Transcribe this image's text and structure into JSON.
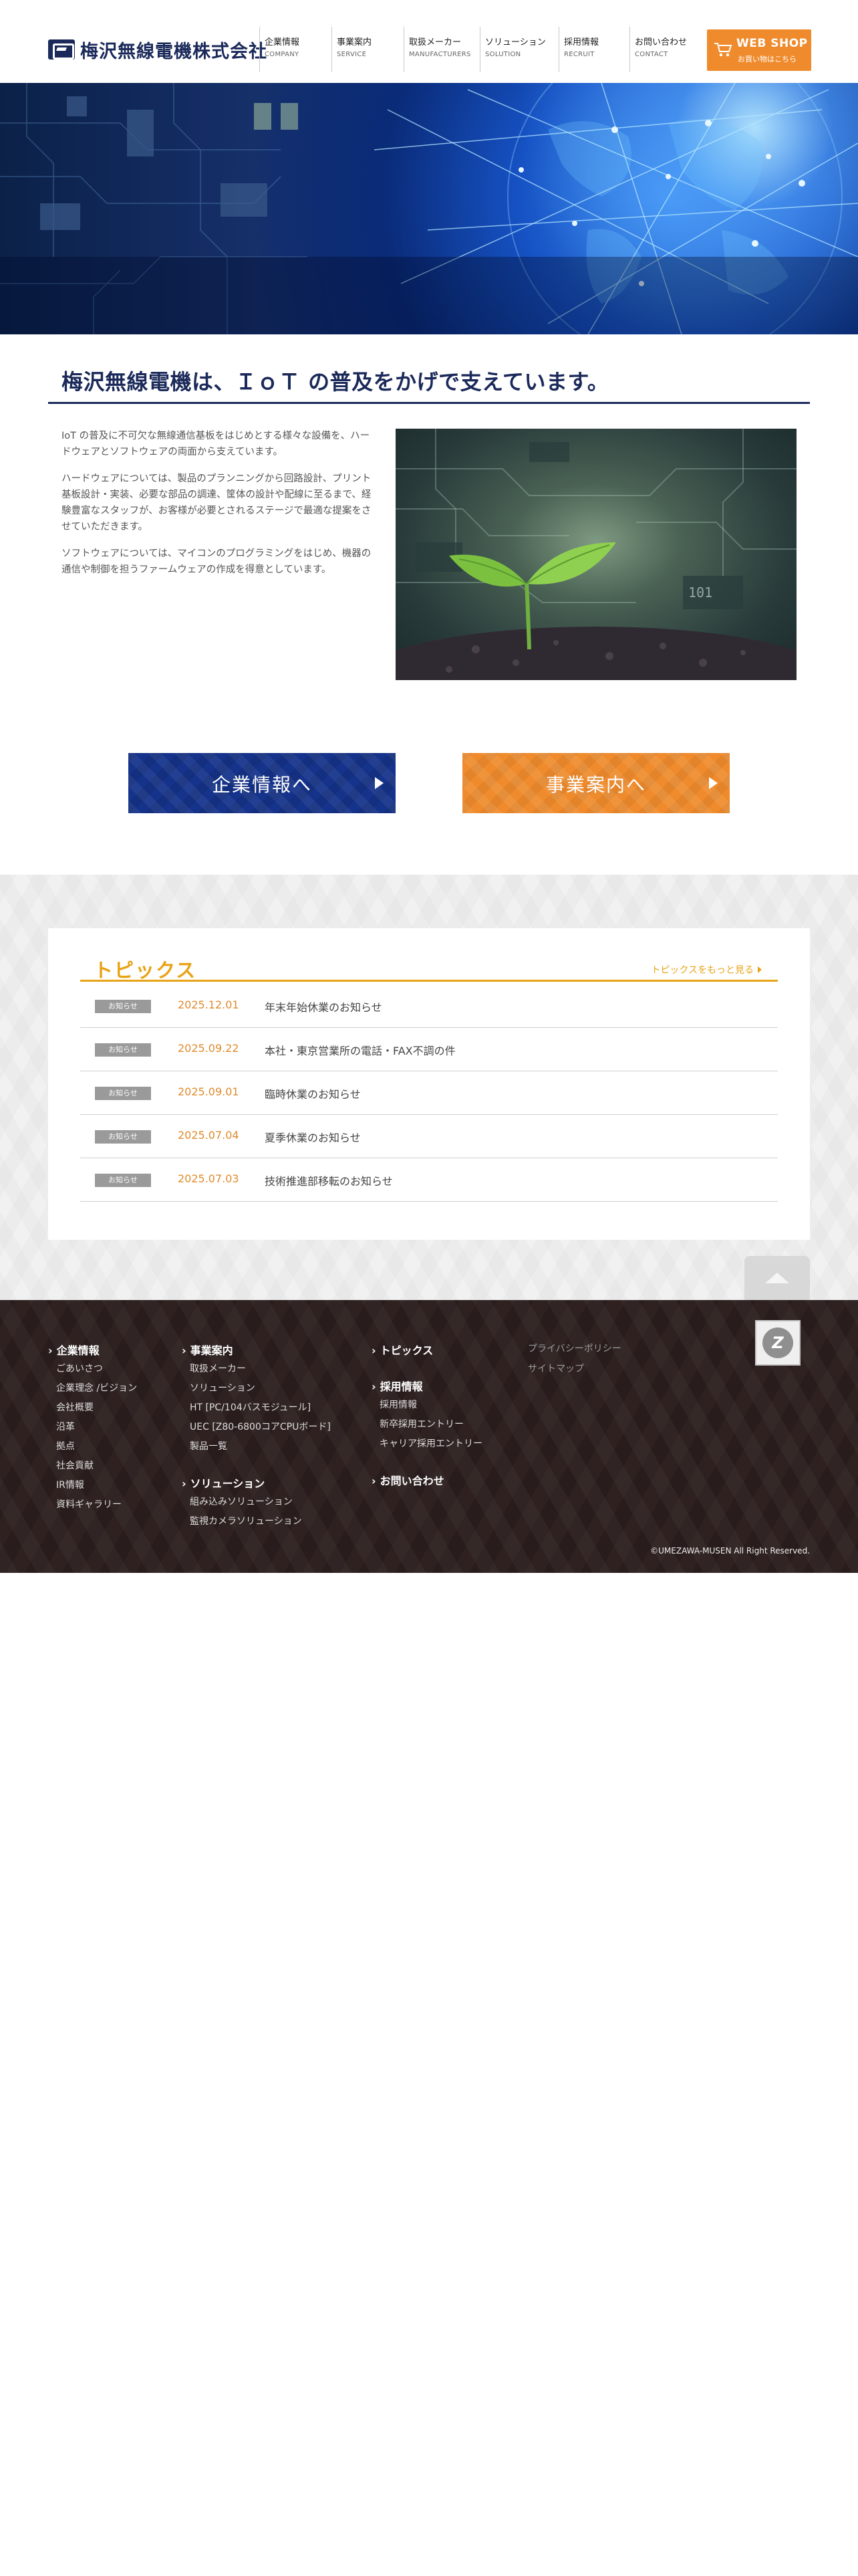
{
  "header": {
    "logo_text": "梅沢無線電機株式会社",
    "nav": [
      {
        "jp": "企業情報",
        "en": "COMPANY"
      },
      {
        "jp": "事業案内",
        "en": "SERVICE"
      },
      {
        "jp": "取扱メーカー",
        "en": "MANUFACTURERS"
      },
      {
        "jp": "ソリューション",
        "en": "SOLUTION"
      },
      {
        "jp": "採用情報",
        "en": "RECRUIT"
      },
      {
        "jp": "お問い合わせ",
        "en": "CONTACT"
      }
    ],
    "webshop": {
      "title": "WEB SHOP",
      "sub": "お買い物はこちら",
      "icon": "cart-icon"
    }
  },
  "intro": {
    "heading": "梅沢無線電機は、ＩｏＴ の普及をかげで支えています。",
    "paragraphs": [
      "IoT の普及に不可欠な無線通信基板をはじめとする様々な設備を、ハードウェアとソフトウェアの両面から支えています。",
      "ハードウェアについては、製品のプランニングから回路設計、プリント基板設計・実装、必要な部品の調達、筐体の設計や配線に至るまで、経験豊富なスタッフが、お客様が必要とされるステージで最適な提案をさせていただきます。",
      "ソフトウェアについては、マイコンのプログラミングをはじめ、機器の通信や制御を担うファームウェアの作成を得意としています。"
    ]
  },
  "buttons": {
    "company": "企業情報へ",
    "service": "事業案内へ"
  },
  "topics": {
    "title": "トピックス",
    "more": "トピックスをもっと見る",
    "items": [
      {
        "badge": "お知らせ",
        "date": "2025.12.01",
        "title": "年末年始休業のお知らせ"
      },
      {
        "badge": "お知らせ",
        "date": "2025.09.22",
        "title": "本社・東京営業所の電話・FAX不調の件"
      },
      {
        "badge": "お知らせ",
        "date": "2025.09.01",
        "title": "臨時休業のお知らせ"
      },
      {
        "badge": "お知らせ",
        "date": "2025.07.04",
        "title": "夏季休業のお知らせ"
      },
      {
        "badge": "お知らせ",
        "date": "2025.07.03",
        "title": "技術推進部移転のお知らせ"
      }
    ]
  },
  "footer": {
    "col1": {
      "head": "企業情報",
      "links": [
        "ごあいさつ",
        "企業理念 /ビジョン",
        "会社概要",
        "沿革",
        "拠点",
        "社会貢献",
        "IR情報",
        "資料ギャラリー"
      ]
    },
    "col2": {
      "head": "事業案内",
      "links": [
        "取扱メーカー",
        "ソリューション",
        "HT [PC/104バスモジュール]",
        "UEC [Z80-6800コアCPUボード]",
        "製品一覧"
      ],
      "head2": "ソリューション",
      "links2": [
        "組み込みソリューション",
        "監視カメラソリューション"
      ]
    },
    "col3": {
      "head": "トピックス",
      "head2": "採用情報",
      "links2": [
        "採用情報",
        "新卒採用エントリー",
        "キャリア採用エントリー"
      ],
      "head3": "お問い合わせ"
    },
    "col4": {
      "links": [
        "プライバシーポリシー",
        "サイトマップ"
      ]
    },
    "copyright": "©UMEZAWA-MUSEN All Right Reserved."
  }
}
